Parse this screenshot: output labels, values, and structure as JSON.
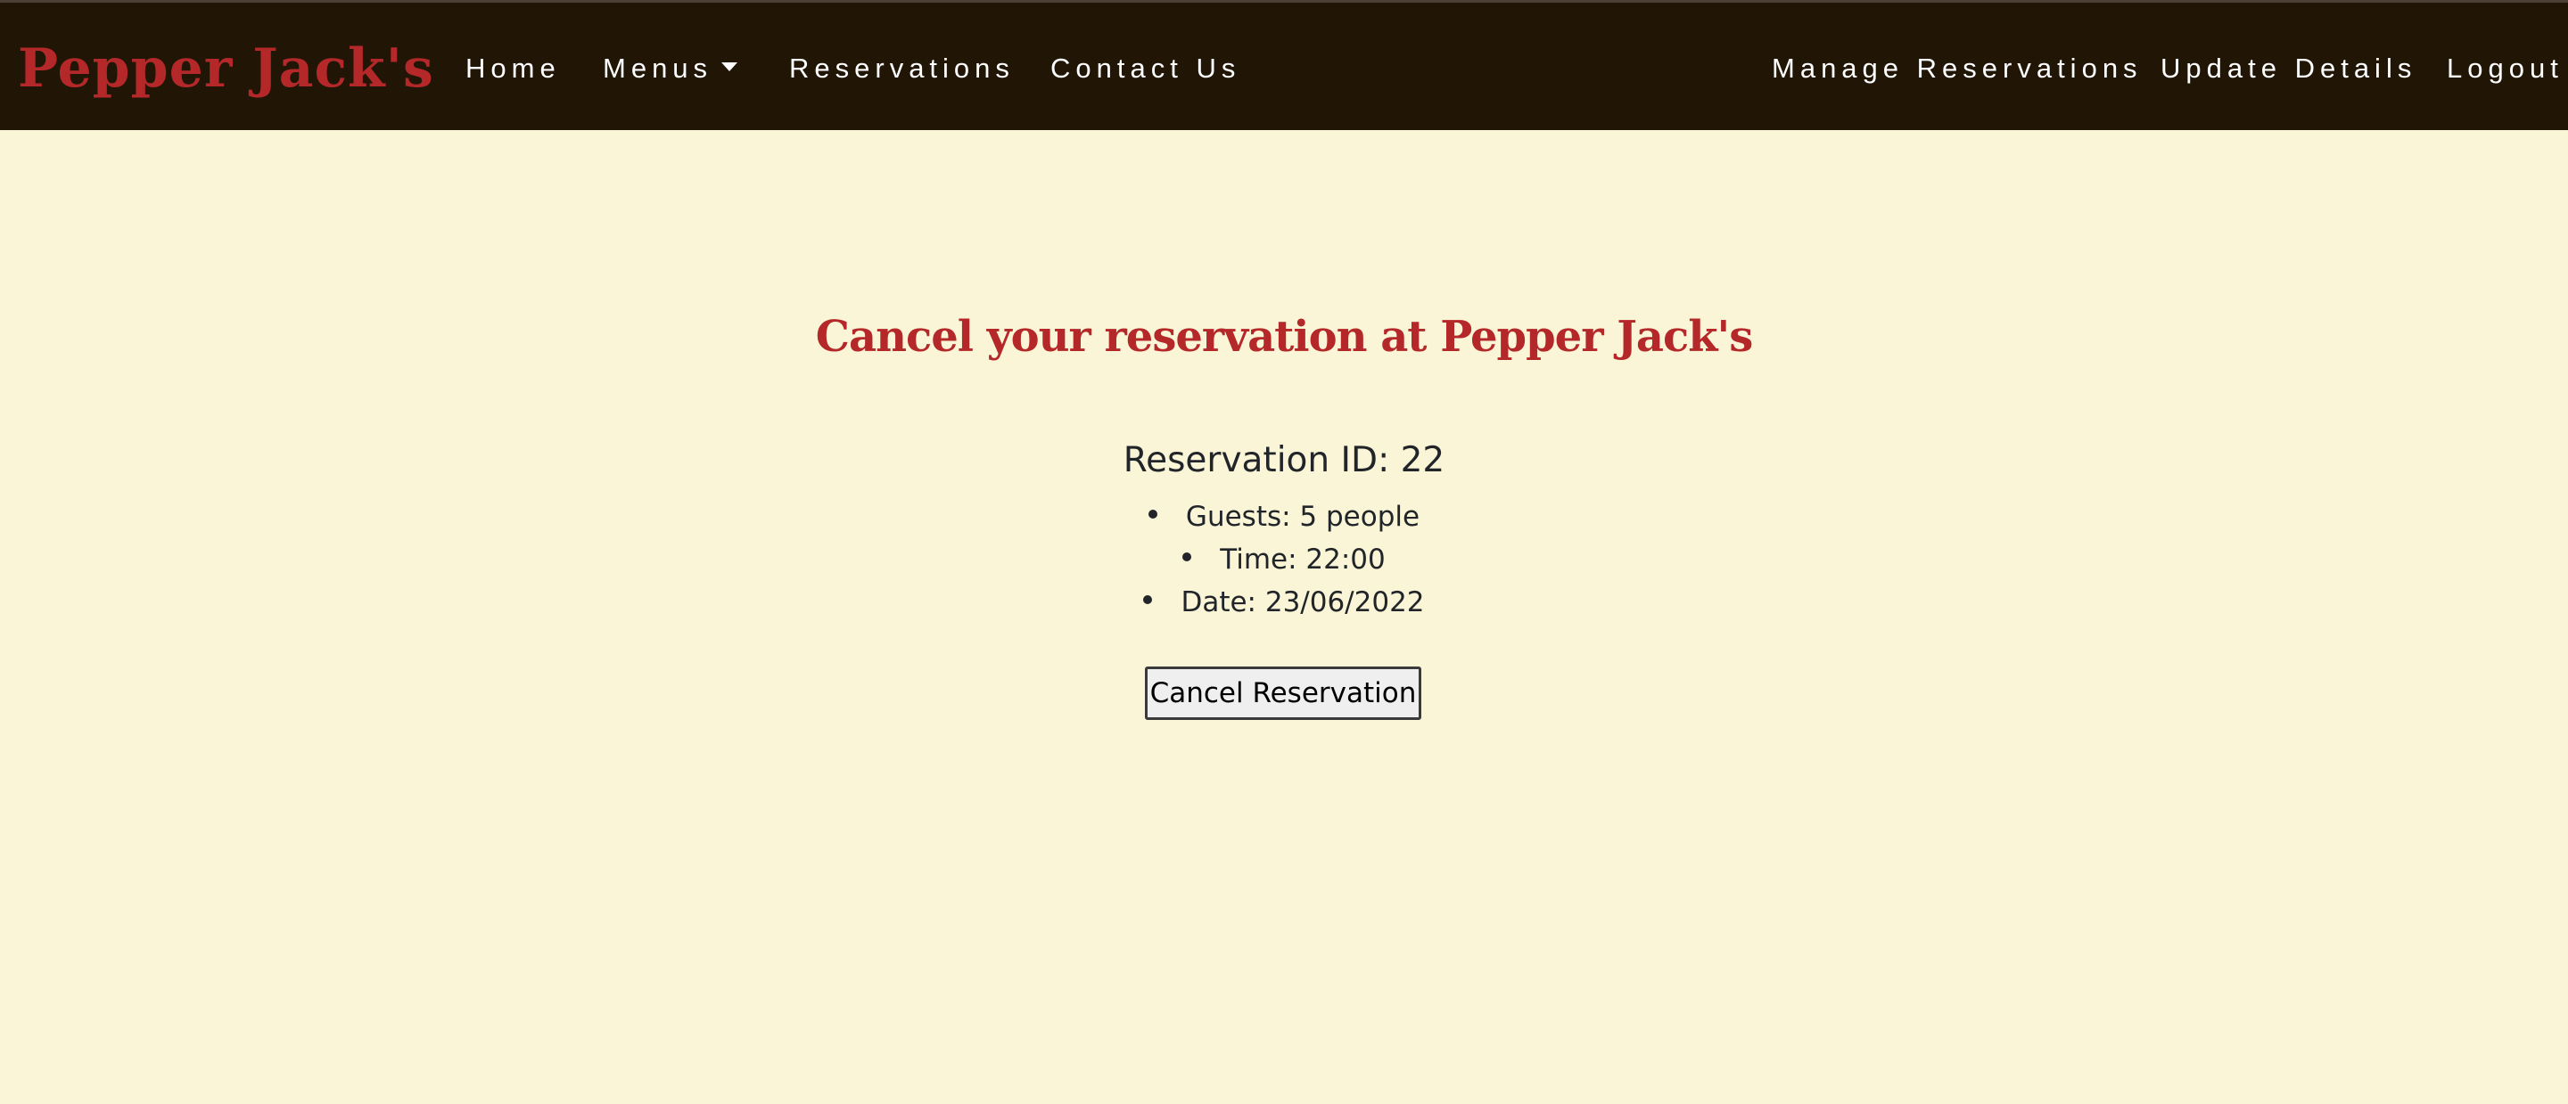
{
  "navbar": {
    "brand": "Pepper Jack's",
    "left_links": [
      {
        "label": "Home"
      },
      {
        "label": "Menus"
      },
      {
        "label": "Reservations"
      },
      {
        "label": "Contact Us"
      }
    ],
    "right_links": [
      {
        "label": "Manage Reservations"
      },
      {
        "label": "Update Details"
      },
      {
        "label": "Logout"
      }
    ],
    "colors": {
      "background": "#211606",
      "brand": "#b5282a",
      "link": "#ffffff"
    }
  },
  "main": {
    "title": "Cancel your reservation at Pepper Jack's",
    "reservation": {
      "heading": "Reservation ID: 22",
      "details": [
        "Guests: 5 people",
        "Time: 22:00",
        "Date: 23/06/2022"
      ]
    },
    "cancel_label": "Cancel Reservation",
    "colors": {
      "page_background": "#faf5d6",
      "title": "#b5282a"
    }
  }
}
